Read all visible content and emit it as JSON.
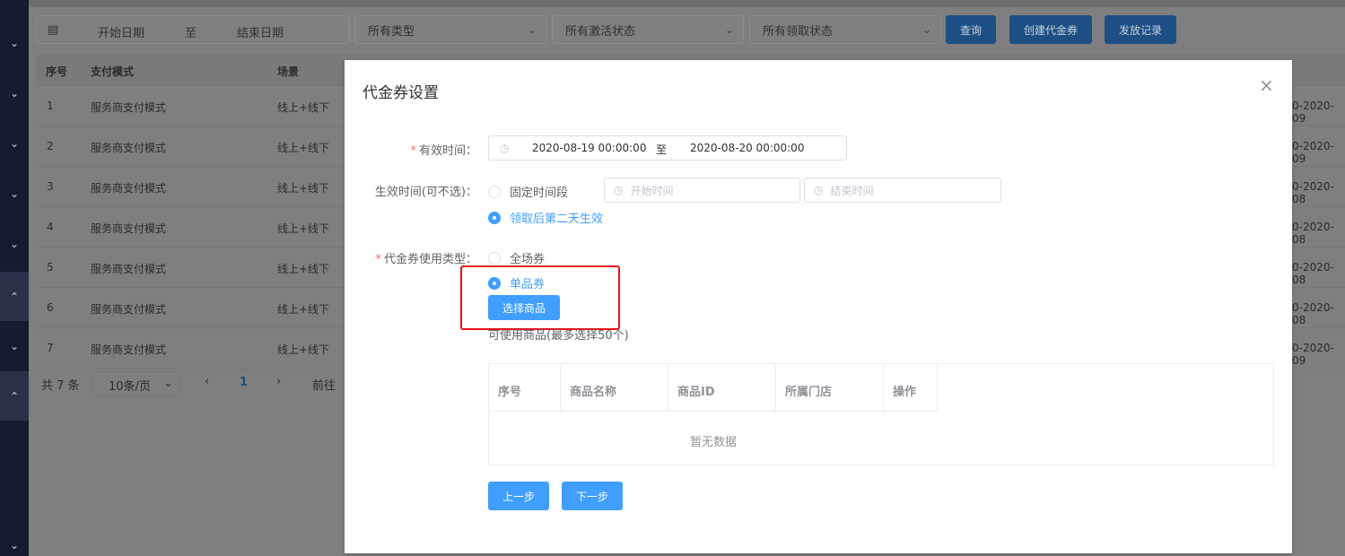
{
  "filters": {
    "start_date_placeholder": "开始日期",
    "range_sep": "至",
    "end_date_placeholder": "结束日期",
    "type_select": "所有类型",
    "activation_select": "所有激活状态",
    "claim_select": "所有领取状态",
    "query_label": "查询",
    "create_label": "创建代金券",
    "records_label": "发放记录"
  },
  "bg_table": {
    "headers": [
      "序号",
      "支付模式",
      "场景"
    ],
    "rows": [
      {
        "no": "1",
        "mode": "服务商支付模式",
        "scene": "线上+线下",
        "tail": "0-2020-09"
      },
      {
        "no": "2",
        "mode": "服务商支付模式",
        "scene": "线上+线下",
        "tail": "0-2020-09"
      },
      {
        "no": "3",
        "mode": "服务商支付模式",
        "scene": "线上+线下",
        "tail": "0-2020-08"
      },
      {
        "no": "4",
        "mode": "服务商支付模式",
        "scene": "线上+线下",
        "tail": "0-2020-08"
      },
      {
        "no": "5",
        "mode": "服务商支付模式",
        "scene": "线上+线下",
        "tail": "0-2020-08"
      },
      {
        "no": "6",
        "mode": "服务商支付模式",
        "scene": "线上+线下",
        "tail": "0-2020-08"
      },
      {
        "no": "7",
        "mode": "服务商支付模式",
        "scene": "线上+线下",
        "tail": "0-2020-09"
      }
    ],
    "pager": {
      "total": "共 7 条",
      "page_size": "10条/页",
      "current_page": "1",
      "goto": "前往"
    }
  },
  "modal": {
    "title": "代金券设置",
    "valid_time": {
      "label": "有效时间：",
      "start": "2020-08-19 00:00:00",
      "sep": "至",
      "end": "2020-08-20 00:00:00"
    },
    "effective_time": {
      "label": "生效时间(可不选)：",
      "fixed_option": "固定时间段",
      "start_placeholder": "开始时间",
      "end_placeholder": "结束时间",
      "next_day_option": "领取后第二天生效"
    },
    "usage_type": {
      "label": "代金券使用类型：",
      "all_option": "全场券",
      "single_option": "单品券",
      "select_goods_label": "选择商品"
    },
    "hint": "可使用商品(最多选择50个)",
    "goods_table": {
      "headers": [
        "序号",
        "商品名称",
        "商品ID",
        "所属门店",
        "操作"
      ],
      "empty_text": "暂无数据"
    },
    "prev_label": "上一步",
    "next_label": "下一步"
  },
  "colors": {
    "primary": "#409eff",
    "required": "#f56c6c",
    "highlight": "#e8101a",
    "sidebar": "#151b30"
  }
}
